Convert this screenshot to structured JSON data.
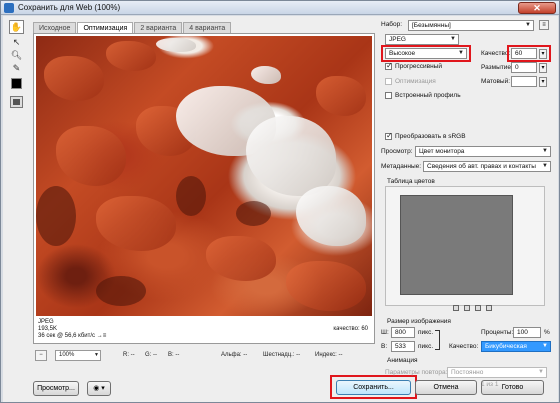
{
  "window": {
    "title": "Сохранить для Web (100%)"
  },
  "tabs": [
    "Исходное",
    "Оптимизация",
    "2 варианта",
    "4 варианта"
  ],
  "image_info": {
    "format": "JPEG",
    "size": "193,5K",
    "time": "36 сек @ 56,6 кбит/с",
    "menu": "→≡",
    "quality": "качество: 60"
  },
  "statusbar": {
    "zoom": "100%",
    "r": "R: --",
    "g": "G: --",
    "b": "B: --",
    "alpha": "Альфа: --",
    "hex": "Шестнадц.: --",
    "index": "Индекс: --"
  },
  "settings": {
    "preset_label": "Набор:",
    "preset_value": "[Безымянны]",
    "format_value": "JPEG",
    "quality_preset": "Высокое",
    "quality_label": "Качество:",
    "quality_value": "60",
    "progressive_label": "Прогрессивный",
    "blur_label": "Размытие:",
    "blur_value": "0",
    "optimized_label": "Оптимизация",
    "matte_label": "Матовый:",
    "icc_label": "Встроенный профиль",
    "srgb_label": "Преобразовать в sRGB",
    "preview_label": "Просмотр:",
    "preview_value": "Цвет монитора",
    "metadata_label": "Метаданные:",
    "metadata_value": "Сведения об авт. правах и контакты",
    "color_table_label": "Таблица цветов"
  },
  "image_size": {
    "title": "Размер изображения",
    "w_label": "Ш:",
    "w_value": "800",
    "unit": "пикс.",
    "h_label": "В:",
    "h_value": "533",
    "percent_label": "Проценты:",
    "percent_value": "100",
    "percent_sign": "%",
    "quality_label": "Качество:",
    "quality_value": "Бикубическая"
  },
  "animation": {
    "title": "Анимация",
    "loop_label": "Параметры повтора:",
    "loop_value": "Постоянно",
    "frame": "1 из 1"
  },
  "buttons": {
    "preview": "Просмотр...",
    "save": "Сохранить...",
    "cancel": "Отмена",
    "done": "Готово"
  },
  "colors": {
    "highlight": "#e0161c",
    "selection": "#3399ff"
  }
}
